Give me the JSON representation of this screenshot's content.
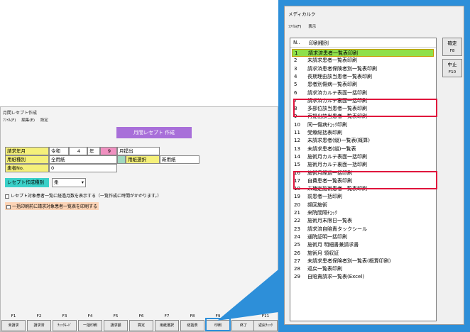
{
  "bg_window": {
    "title": "月間レセプト作成",
    "menu": [
      "ﾌｧｲﾙ(F)",
      "編集(E)",
      "設定"
    ],
    "banner": "月間レセプト 作成",
    "claim_year_month_label": "請求年月",
    "era": "令和",
    "year": "4",
    "year_unit": "年",
    "month": "9",
    "month_unit": "月提出",
    "paper_type_label": "用紙種別",
    "paper_type_value": "全用紙",
    "paper_select_label": "用紙選択",
    "paper_select_value": "新用紙",
    "patient_no_label": "患者No.",
    "patient_no_value": "0",
    "rece_type_label": "レセプト作成種別",
    "rece_type_value": "柔",
    "check1": "レセプト対象患者一覧に経過月数を表示する（一覧作成に時間がかかります。）",
    "check2": "一括印刷前に請求対象患者一覧表を印刷する"
  },
  "fkeys": [
    {
      "key": "F1",
      "label": "未請求"
    },
    {
      "key": "F2",
      "label": "請求済"
    },
    {
      "key": "F3",
      "label": "ﾁｪｯｸﾓｰﾄﾞ"
    },
    {
      "key": "F4",
      "label": "一括印刷"
    },
    {
      "key": "F5",
      "label": "請求額"
    },
    {
      "key": "F6",
      "label": "算定"
    },
    {
      "key": "F7",
      "label": "用紙選択"
    },
    {
      "key": "F8",
      "label": "総括表"
    },
    {
      "key": "F9",
      "label": "印刷"
    },
    {
      "key": "",
      "label": "終了"
    },
    {
      "key": "F11",
      "label": "返戻ﾁｪｯｸ"
    }
  ],
  "dialog": {
    "title": "メディカルク",
    "menu": [
      "ﾌｧｲﾙ(F)",
      "表示"
    ],
    "col_no": "N..",
    "col_type": "印刷種別",
    "confirm_label": "確定",
    "confirm_key": "F8",
    "cancel_label": "中止",
    "cancel_key": "F10",
    "items": [
      {
        "n": "1",
        "t": "請求済患者一覧表印刷"
      },
      {
        "n": "2",
        "t": "未請求患者一覧表印刷"
      },
      {
        "n": "3",
        "t": "請求済患者保険者別一覧表印刷"
      },
      {
        "n": "4",
        "t": "長期理由該当患者一覧表印刷"
      },
      {
        "n": "5",
        "t": "患者別傷病一覧表印刷"
      },
      {
        "n": "6",
        "t": "請求済カルテ表面一括印刷"
      },
      {
        "n": "7",
        "t": "請求済カルテ裏面一括印刷"
      },
      {
        "n": "8",
        "t": "多部位該当患者一覧表印刷"
      },
      {
        "n": "9",
        "t": "再提出該当患者一覧表印刷"
      },
      {
        "n": "10",
        "t": "同一傷病ﾁｪｯｸ印刷"
      },
      {
        "n": "11",
        "t": "受療総括表印刷"
      },
      {
        "n": "12",
        "t": "未請求患者(縦)一覧表(概算)"
      },
      {
        "n": "13",
        "t": "未請求患者(縦)一覧表"
      },
      {
        "n": "14",
        "t": "施術月カルテ表面一括印刷"
      },
      {
        "n": "15",
        "t": "施術月カルテ裏面一括印刷"
      },
      {
        "n": "16",
        "t": "施術月経過一括印刷"
      },
      {
        "n": "17",
        "t": "自費患者一覧表印刷"
      },
      {
        "n": "18",
        "t": "未確定施術患者一覧表印刷"
      },
      {
        "n": "19",
        "t": "前患者一括印刷"
      },
      {
        "n": "20",
        "t": "頻回施術"
      },
      {
        "n": "21",
        "t": "来院間隔ﾁｪｯｸ"
      },
      {
        "n": "22",
        "t": "施術月末限日一覧表"
      },
      {
        "n": "23",
        "t": "請求済自賠責タックシール"
      },
      {
        "n": "24",
        "t": "通院証明一括印刷"
      },
      {
        "n": "25",
        "t": "施術月 明細書兼請求書"
      },
      {
        "n": "26",
        "t": "施術月 領収証"
      },
      {
        "n": "27",
        "t": "未請求患者保険者別一覧表(概算印刷)"
      },
      {
        "n": "28",
        "t": "返戻一覧表印刷"
      },
      {
        "n": "29",
        "t": "自賠責請求一覧表(Excel)"
      }
    ]
  },
  "colors": {
    "frame": "#2d8fd9",
    "highlight": "#8fe04a",
    "box": "#e0143c",
    "banner": "#a86fd9"
  }
}
